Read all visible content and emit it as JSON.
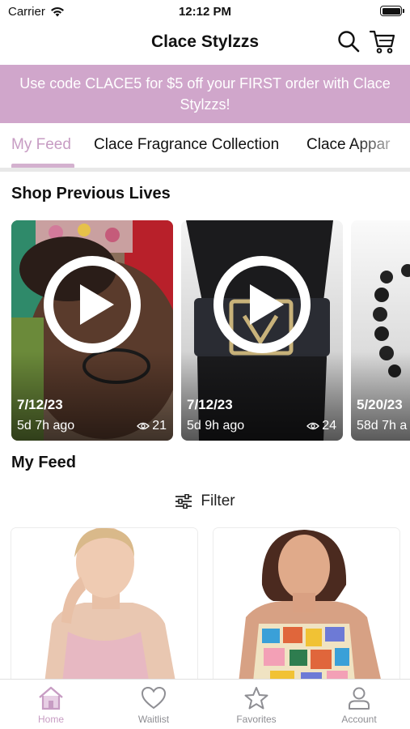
{
  "status_bar": {
    "carrier": "Carrier",
    "time": "12:12 PM"
  },
  "nav": {
    "title": "Clace Stylzzs"
  },
  "promo": {
    "text": "Use code CLACE5 for $5 off your FIRST order with Clace Stylzzs!"
  },
  "tabs": [
    {
      "label": "My Feed",
      "active": true
    },
    {
      "label": "Clace Fragrance Collection",
      "active": false
    },
    {
      "label": "Clace Appar",
      "active": false
    }
  ],
  "sections": {
    "previous_lives": "Shop Previous Lives",
    "my_feed": "My Feed"
  },
  "lives": [
    {
      "date": "7/12/23",
      "ago": "5d 7h ago",
      "views": "21"
    },
    {
      "date": "7/12/23",
      "ago": "5d 9h ago",
      "views": "24"
    },
    {
      "date": "5/20/23",
      "ago": "58d 7h a",
      "views": ""
    }
  ],
  "filter": {
    "label": "Filter"
  },
  "tab_bar": [
    {
      "label": "Home",
      "icon": "home-icon",
      "active": true
    },
    {
      "label": "Waitlist",
      "icon": "heart-icon",
      "active": false
    },
    {
      "label": "Favorites",
      "icon": "star-icon",
      "active": false
    },
    {
      "label": "Account",
      "icon": "person-icon",
      "active": false
    }
  ],
  "colors": {
    "accent": "#c79cc3",
    "banner": "#d0a6cb",
    "inactive": "#8e8e93"
  }
}
